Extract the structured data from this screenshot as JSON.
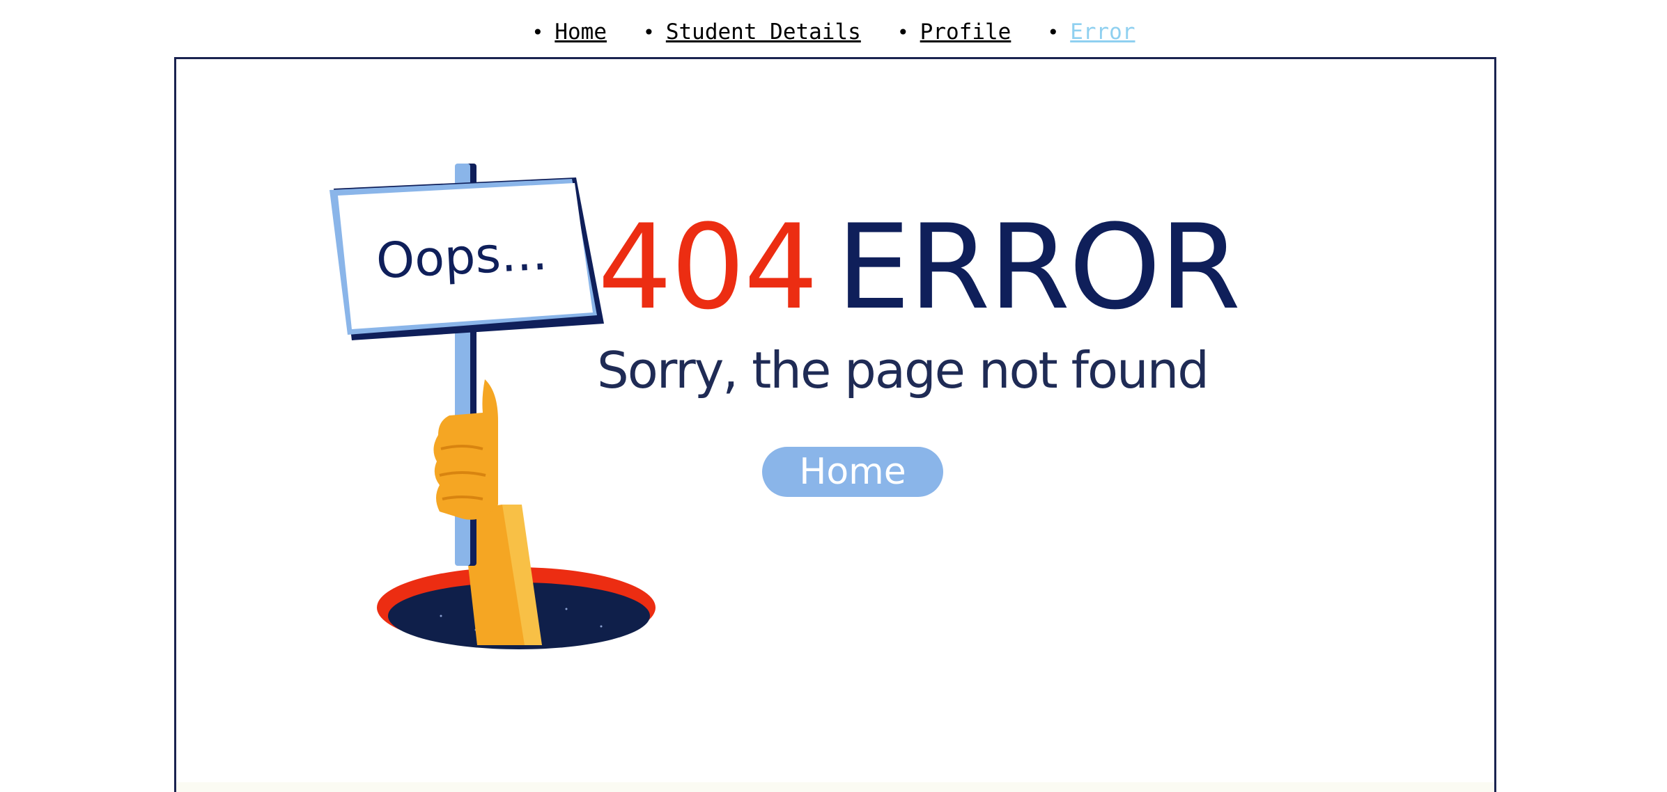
{
  "nav": {
    "items": [
      {
        "label": "Home",
        "active": false
      },
      {
        "label": "Student Details",
        "active": false
      },
      {
        "label": "Profile",
        "active": false
      },
      {
        "label": "Error",
        "active": true
      }
    ]
  },
  "error": {
    "sign_text": "Oops...",
    "code": "404",
    "title": "ERROR",
    "message": "Sorry, the page not found",
    "home_button": "Home"
  },
  "colors": {
    "accent_red": "#ec2d12",
    "navy": "#0f1f5a",
    "button_blue": "#8ab5e9",
    "active_link": "#8fd0f0",
    "frame_border": "#1a2350"
  }
}
